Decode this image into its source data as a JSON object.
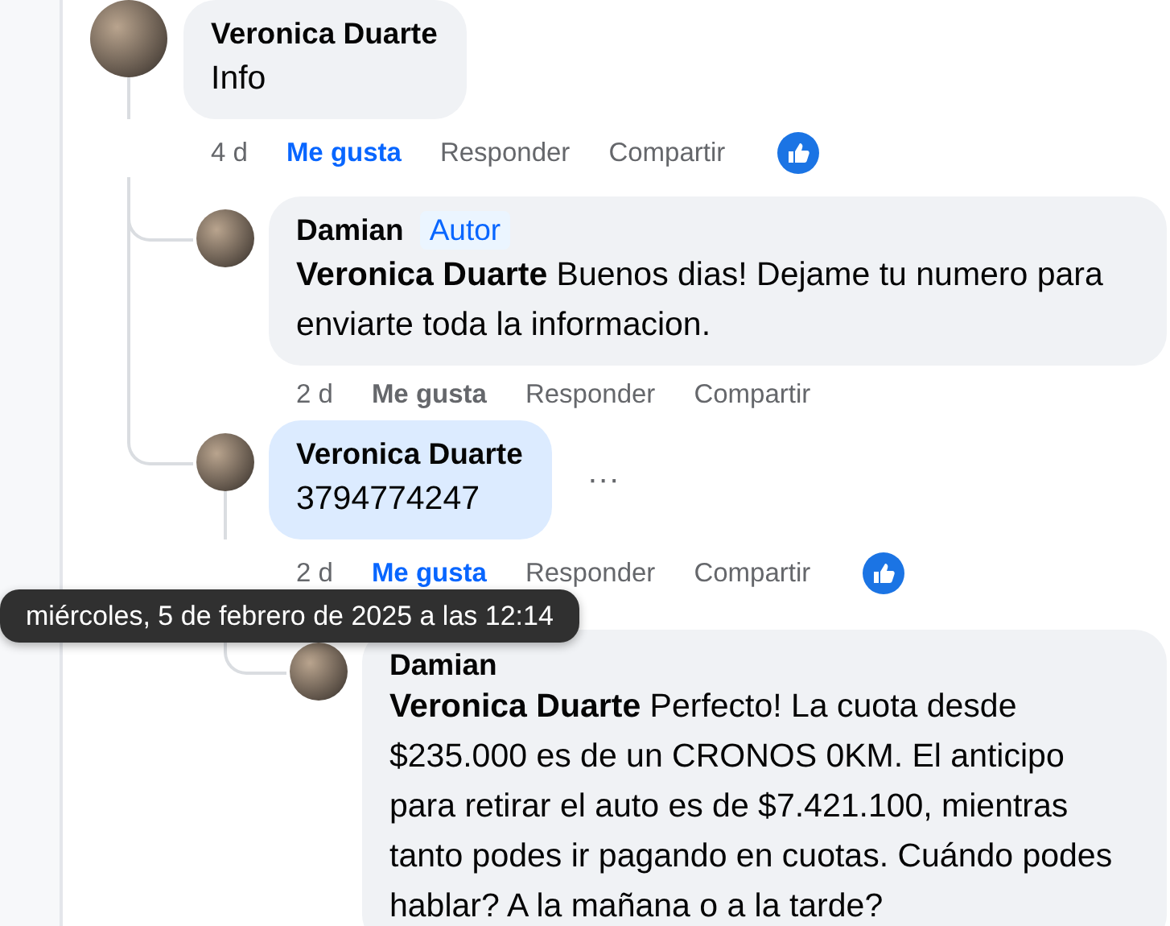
{
  "comments": [
    {
      "author": "Veronica Duarte",
      "text": "Info",
      "highlighted": false,
      "time": "4 d",
      "like_label": "Me gusta",
      "liked": true,
      "reply_label": "Responder",
      "share_label": "Compartir",
      "has_reactions": true,
      "children": [
        {
          "author": "Damian",
          "badge": "Autor",
          "text": "**Veronica Duarte** Buenos dias! Dejame tu numero para enviarte toda la informacion.",
          "highlighted": false,
          "time": "2 d",
          "like_label": "Me gusta",
          "liked": false,
          "reply_label": "Responder",
          "share_label": "Compartir",
          "has_reactions": false
        },
        {
          "author": "Veronica Duarte",
          "text": "3794774247",
          "highlighted": true,
          "menu": "···",
          "time": "2 d",
          "like_label": "Me gusta",
          "liked": true,
          "reply_label": "Responder",
          "share_label": "Compartir",
          "has_reactions": true,
          "children": [
            {
              "author": "Damian",
              "text": "**Veronica Duarte** Perfecto! La cuota desde $235.000 es de un CRONOS 0KM. El anticipo para retirar el auto es de $7.421.100, mientras tanto podes ir pagando en cuotas. Cuándo podes hablar? A la mañana o a la tarde?",
              "highlighted": false
            }
          ]
        }
      ]
    }
  ],
  "tooltip": {
    "text": "miércoles, 5 de febrero de 2025 a las 12:14"
  }
}
